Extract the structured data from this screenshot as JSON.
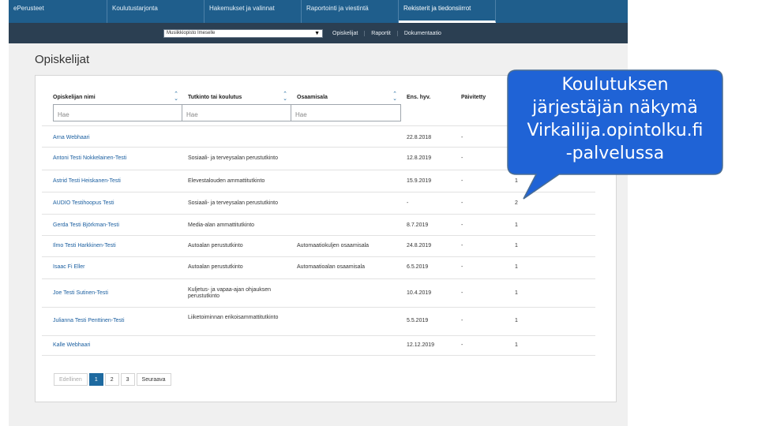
{
  "topnav": {
    "items": [
      "ePerusteet",
      "Koulutustarjonta",
      "Hakemukset ja valinnat",
      "Raportointi ja viestintä",
      "Rekisterit ja tiedonsiirrot"
    ]
  },
  "subnav": {
    "organisation_select": "Musiikkiopisto Imeselle",
    "links": [
      "Opiskelijat",
      "Raportit",
      "Dokumentaatio"
    ]
  },
  "page": {
    "title": "Opiskelijat"
  },
  "table": {
    "headers": [
      "Opiskelijan nimi",
      "Tutkinto tai koulutus",
      "Osaamisala",
      "Ens. hyv.",
      "Päivitetty"
    ],
    "filter_placeholder": "Hae",
    "rows": [
      {
        "name": "Arna Webhaari",
        "degree": "",
        "field": "",
        "date": "22.8.2018",
        "updated": "-",
        "count": ""
      },
      {
        "name": "Antoni Testi Nokkelainen-Testi",
        "degree": "Sosiaali- ja terveysalan perustutkinto",
        "field": "",
        "date": "12.8.2019",
        "updated": "-",
        "count": ""
      },
      {
        "name": "Astrid Testi Heiskanen-Testi",
        "degree": "Elevestalouden ammattitutkinto",
        "field": "",
        "date": "15.9.2019",
        "updated": "-",
        "count": "1"
      },
      {
        "name": "AUDIO Testihoopus Testi",
        "degree": "Sosiaali- ja terveysalan perustutkinto",
        "field": "",
        "date": "-",
        "updated": "-",
        "count": "2"
      },
      {
        "name": "Gerda Testi Björkman-Testi",
        "degree": "Media-alan ammattitutkinto",
        "field": "",
        "date": "8.7.2019",
        "updated": "-",
        "count": "1"
      },
      {
        "name": "Ilmo Testi Harkkinen-Testi",
        "degree": "Autoalan perustutkinto",
        "field": "Automaatiokuljen osaamisala",
        "date": "24.8.2019",
        "updated": "-",
        "count": "1"
      },
      {
        "name": "Isaac Fi Eller",
        "degree": "Autoalan perustutkinto",
        "field": "Automaatioalan osaamisala",
        "date": "6.5.2019",
        "updated": "-",
        "count": "1"
      },
      {
        "name": "Joe Testi Sutinen-Testi",
        "degree": "Kuljetus- ja vapaa-ajan ohjauksen perustutkinto",
        "field": "",
        "date": "10.4.2019",
        "updated": "-",
        "count": "1"
      },
      {
        "name": "Julianna Testi Penttinen-Testi",
        "degree": "Liiketoiminnan erikoisammattitutkinto",
        "field": "",
        "date": "5.5.2019",
        "updated": "-",
        "count": "1"
      },
      {
        "name": "Kalle Webhaari",
        "degree": "",
        "field": "",
        "date": "12.12.2019",
        "updated": "-",
        "count": "1"
      }
    ]
  },
  "pagination": {
    "previous": "Edellinen",
    "pages": [
      "1",
      "2",
      "3"
    ],
    "next": "Seuraava"
  },
  "callout": {
    "lines": [
      "Koulutuksen",
      "järjestäjän näkymä",
      "Virkailija.opintolku.fi",
      "-palvelussa"
    ],
    "fill_color": "#1f63d6",
    "stroke_color": "#4a6d93"
  }
}
